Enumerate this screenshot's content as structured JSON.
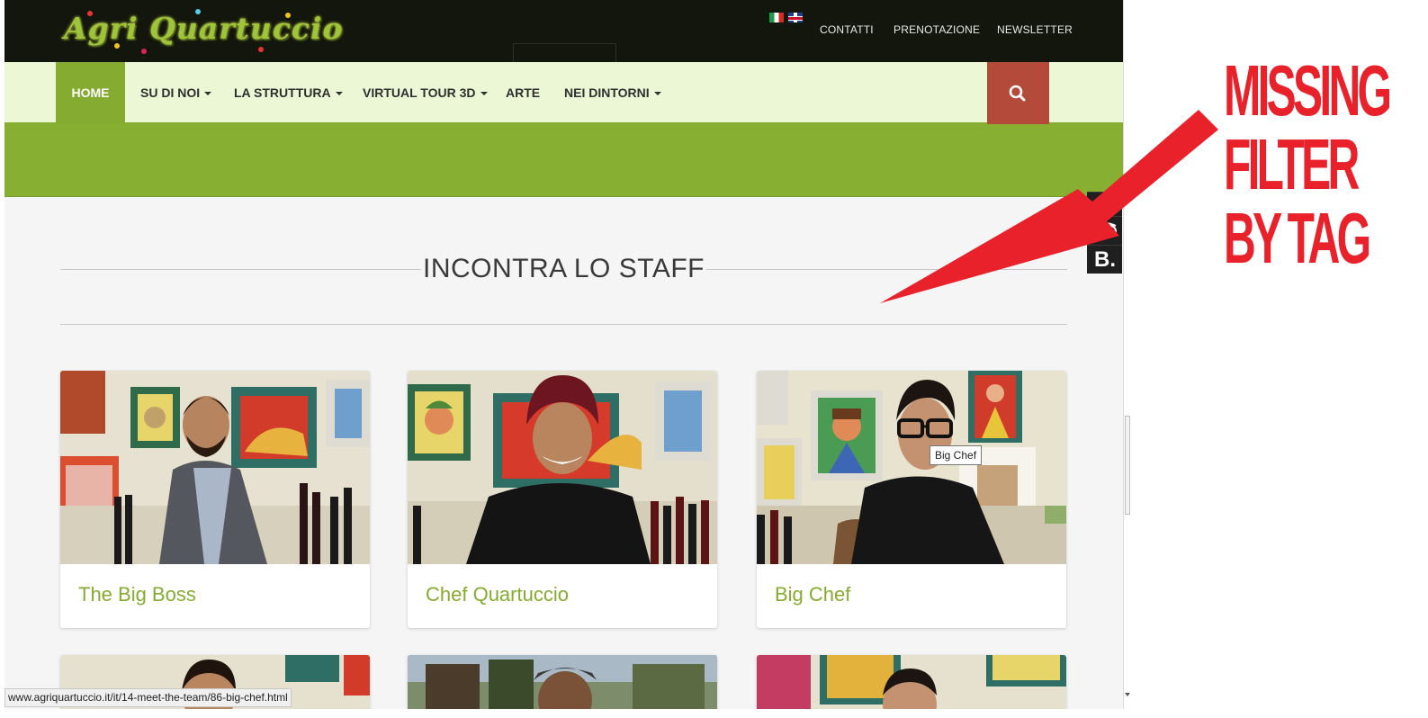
{
  "site": {
    "logo_text": "Agri Quartuccio",
    "flags": [
      "italian-flag",
      "english-flag"
    ],
    "top_links": [
      "CONTATTI",
      "PRENOTAZIONE",
      "NEWSLETTER"
    ]
  },
  "nav": {
    "items": [
      {
        "label": "HOME",
        "active": true,
        "dropdown": false
      },
      {
        "label": "SU DI NOI",
        "active": false,
        "dropdown": true
      },
      {
        "label": "LA STRUTTURA",
        "active": false,
        "dropdown": true
      },
      {
        "label": "VIRTUAL TOUR 3D",
        "active": false,
        "dropdown": true
      },
      {
        "label": "ARTE",
        "active": false,
        "dropdown": false
      },
      {
        "label": "NEI DINTORNI",
        "active": false,
        "dropdown": true
      }
    ],
    "search_icon": "search-icon"
  },
  "social": [
    "facebook-icon",
    "tripadvisor-icon",
    "booking-icon"
  ],
  "social_labels": {
    "facebook": "f",
    "booking": "B."
  },
  "section": {
    "title": "INCONTRA LO STAFF"
  },
  "staff": [
    {
      "name": "The Big Boss"
    },
    {
      "name": "Chef Quartuccio"
    },
    {
      "name": "Big Chef"
    }
  ],
  "tooltip": "Big Chef",
  "status_url": "www.agriquartuccio.it/it/14-meet-the-team/86-big-chef.html",
  "annotation": {
    "lines": [
      "MISSING",
      "FILTER",
      "BY TAG"
    ]
  },
  "colors": {
    "brand_green": "#85ac30",
    "nav_bg": "#ecf8d5",
    "top_bg": "#13160c",
    "search_bg": "#b44a39",
    "annotation_red": "#e8212a"
  }
}
